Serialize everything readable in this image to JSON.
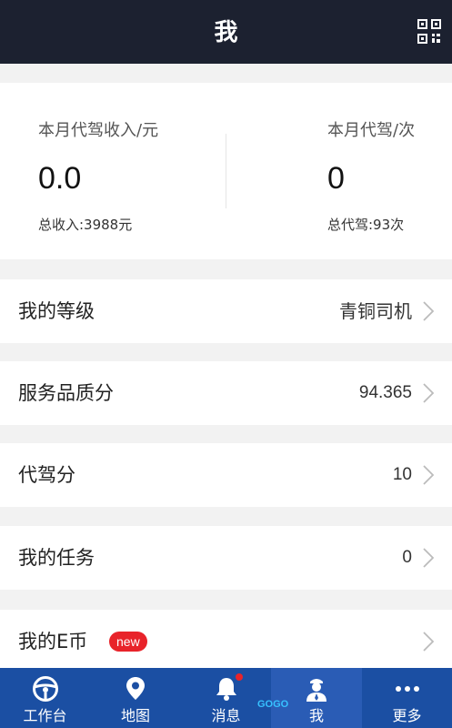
{
  "header": {
    "title": "我",
    "qr_icon": "qr-code-icon"
  },
  "stats": {
    "left": {
      "label": "本月代驾收入/元",
      "value": "0.0",
      "sub": "总收入:3988元"
    },
    "right": {
      "label": "本月代驾/次",
      "value": "0",
      "sub": "总代驾:93次"
    }
  },
  "rows": [
    {
      "label": "我的等级",
      "value": "青铜司机"
    },
    {
      "label": "服务品质分",
      "value": "94.365"
    },
    {
      "label": "代驾分",
      "value": "10"
    },
    {
      "label": "我的任务",
      "value": "0"
    },
    {
      "label": "我的E币",
      "badge": "new",
      "value": ""
    }
  ],
  "tabbar": {
    "items": [
      {
        "label": "工作台",
        "icon": "steering-wheel-icon"
      },
      {
        "label": "地图",
        "icon": "map-pin-icon"
      },
      {
        "label": "消息",
        "icon": "bell-icon"
      },
      {
        "label": "我",
        "icon": "driver-icon",
        "active": true
      },
      {
        "label": "更多",
        "icon": "more-dots-icon"
      }
    ]
  },
  "watermark": "GOGO",
  "colors": {
    "header_bg": "#1c2130",
    "tabbar_bg": "#1b4fa3",
    "badge": "#e8232a"
  }
}
